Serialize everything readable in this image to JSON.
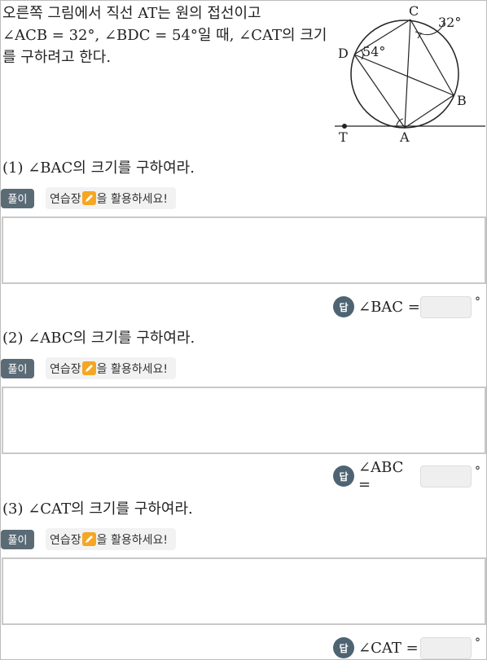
{
  "problem": {
    "line1": "오른쪽 그림에서 직선 AT는 원의 접선이고",
    "line2": "∠ACB = 32°, ∠BDC = 54°일 때, ∠CAT의 크기",
    "line3": "를 구하려고 한다."
  },
  "figure": {
    "labels": {
      "C": "C",
      "D": "D",
      "B": "B",
      "A": "A",
      "T": "T"
    },
    "angle_c": "32°",
    "angle_d": "54°"
  },
  "questions": [
    {
      "title": "(1) ∠BAC의 크기를 구하여라.",
      "solution_label": "풀이",
      "practice_prefix": "연습장",
      "practice_suffix": "을 활용하세요!",
      "answer_badge": "답",
      "answer_label": "∠BAC =",
      "answer_value": "",
      "answer_unit": "°"
    },
    {
      "title": "(2) ∠ABC의 크기를 구하여라.",
      "solution_label": "풀이",
      "practice_prefix": "연습장",
      "practice_suffix": "을 활용하세요!",
      "answer_badge": "답",
      "answer_label": "∠ABC =",
      "answer_value": "",
      "answer_unit": "°"
    },
    {
      "title": "(3) ∠CAT의 크기를 구하여라.",
      "solution_label": "풀이",
      "practice_prefix": "연습장",
      "practice_suffix": "을 활용하세요!",
      "answer_badge": "답",
      "answer_label": "∠CAT =",
      "answer_value": "",
      "answer_unit": "°"
    }
  ]
}
